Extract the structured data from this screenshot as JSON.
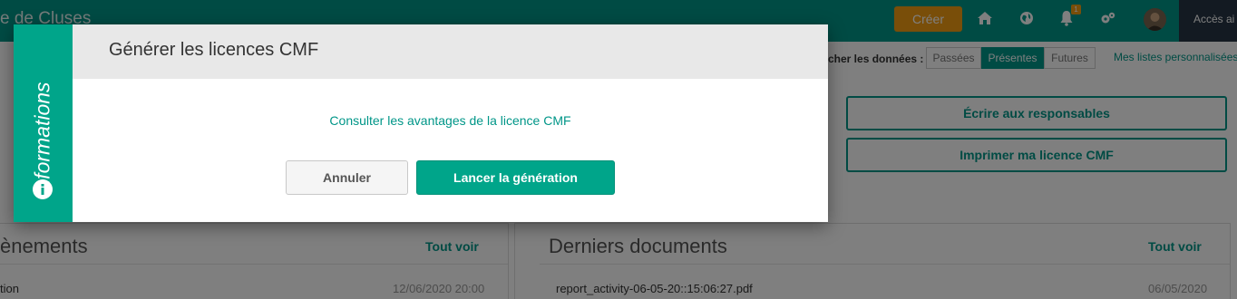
{
  "topbar": {
    "app_title": "e de Cluses",
    "create_button": "Créer",
    "notification_count": "1",
    "access_label": "Accès ai",
    "icons": [
      "home-icon",
      "globe-icon",
      "bell-icon",
      "gears-icon"
    ]
  },
  "filters": {
    "label": "cher les données :",
    "options": [
      "Passées",
      "Présentes",
      "Futures"
    ],
    "selected": "Présentes",
    "lists_link": "Mes listes personnalisées"
  },
  "actions": {
    "write_button": "Écrire aux responsables",
    "print_button": "Imprimer ma licence CMF"
  },
  "events_panel": {
    "title": "ènements",
    "see_all": "Tout voir",
    "row_text": "tion",
    "row_date": "12/06/2020 20:00"
  },
  "documents_panel": {
    "title": "Derniers documents",
    "see_all": "Tout voir",
    "row_text": "report_activity-06-05-20::15:06:27.pdf",
    "row_date": "06/05/2020"
  },
  "modal": {
    "side_label": "Informations",
    "title": "Générer les licences CMF",
    "info_link": "Consulter les avantages de la licence CMF",
    "cancel_button": "Annuler",
    "launch_button": "Lancer la génération"
  },
  "colors": {
    "primary": "#009688",
    "accent": "#00a58a",
    "warning": "#f39c12",
    "dark": "#263544"
  }
}
